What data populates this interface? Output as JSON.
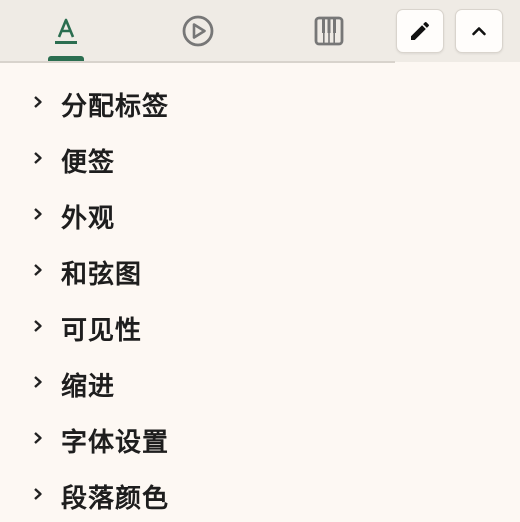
{
  "toolbar": {
    "tabs": [
      {
        "name": "text-tab",
        "icon": "text-format-icon",
        "active": true
      },
      {
        "name": "playback-tab",
        "icon": "play-circle-icon",
        "active": false
      },
      {
        "name": "piano-tab",
        "icon": "piano-icon",
        "active": false
      }
    ],
    "edit_button_icon": "pencil-icon",
    "collapse_button_icon": "chevron-up-icon",
    "accent_color": "#2b6e50"
  },
  "sections": [
    {
      "label": "分配标签"
    },
    {
      "label": "便签"
    },
    {
      "label": "外观"
    },
    {
      "label": "和弦图"
    },
    {
      "label": "可见性"
    },
    {
      "label": "缩进"
    },
    {
      "label": "字体设置"
    },
    {
      "label": "段落颜色"
    }
  ]
}
